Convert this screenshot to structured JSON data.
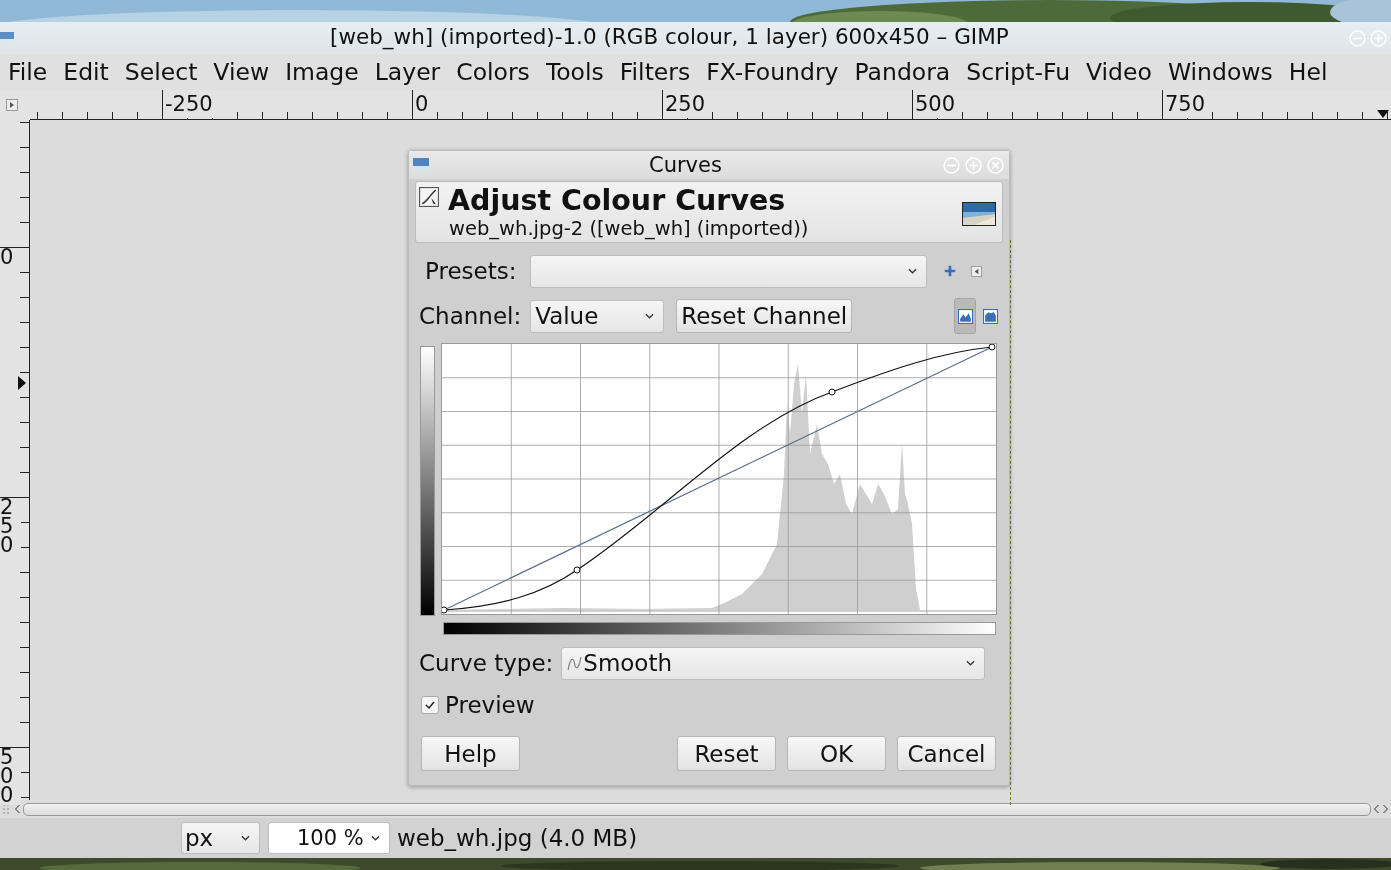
{
  "window": {
    "title": "[web_wh] (imported)-1.0 (RGB colour, 1 layer) 600x450 – GIMP"
  },
  "menu": [
    "File",
    "Edit",
    "Select",
    "View",
    "Image",
    "Layer",
    "Colors",
    "Tools",
    "Filters",
    "FX-Foundry",
    "Pandora",
    "Script-Fu",
    "Video",
    "Windows",
    "Hel"
  ],
  "rulers": {
    "horizontal": [
      "-250",
      "0",
      "250",
      "500",
      "750"
    ],
    "vertical": [
      "0",
      "250",
      "500"
    ]
  },
  "dialog": {
    "title": "Curves",
    "heading": "Adjust Colour Curves",
    "subtitle": "web_wh.jpg-2 ([web_wh] (imported))",
    "presets": {
      "label": "Presets:"
    },
    "channel": {
      "label": "Channel:",
      "value": "Value"
    },
    "reset_channel": "Reset Channel",
    "view_modes": [
      {
        "selected": true
      },
      {
        "selected": false
      }
    ],
    "curve_type": {
      "label": "Curve type:",
      "value": "Smooth"
    },
    "preview": {
      "label": "Preview",
      "checked": true
    },
    "buttons": [
      "Help",
      "Reset",
      "OK",
      "Cancel"
    ]
  },
  "status_bar": {
    "unit": "px",
    "zoom": "100 %",
    "file_info": "web_wh.jpg (4.0 MB)"
  }
}
